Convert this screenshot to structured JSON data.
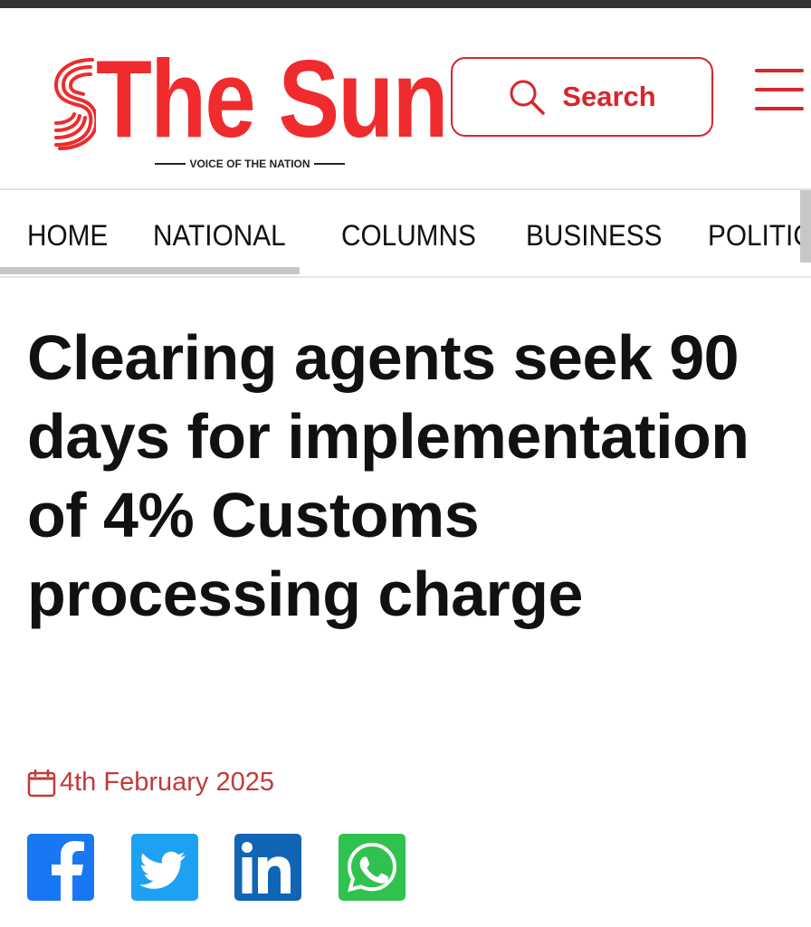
{
  "header": {
    "logo_text": "The Sun",
    "tagline": "VOICE OF THE NATION",
    "search_label": "Search",
    "icons": {
      "search": "search-icon",
      "menu": "hamburger-menu-icon",
      "logo": "sun-swirl-logo"
    }
  },
  "nav": {
    "items": [
      {
        "label": "HOME"
      },
      {
        "label": "NATIONAL"
      },
      {
        "label": "COLUMNS"
      },
      {
        "label": "BUSINESS"
      },
      {
        "label": "POLITIC"
      }
    ]
  },
  "article": {
    "headline": "Clearing agents seek 90 days for implementation of 4% Customs processing charge",
    "date": "4th February 2025",
    "date_icon": "calendar-icon"
  },
  "share": {
    "buttons": [
      {
        "network": "facebook",
        "icon": "facebook-icon",
        "color": "#1877f2"
      },
      {
        "network": "twitter",
        "icon": "twitter-icon",
        "color": "#1da1f2"
      },
      {
        "network": "linkedin",
        "icon": "linkedin-icon",
        "color": "#0a66c2"
      },
      {
        "network": "whatsapp",
        "icon": "whatsapp-icon",
        "color": "#25d366"
      }
    ]
  },
  "colors": {
    "brand_red": "#ef2b2d",
    "accent_red": "#d8262b",
    "date_red": "#c23a3a",
    "text": "#111111"
  }
}
